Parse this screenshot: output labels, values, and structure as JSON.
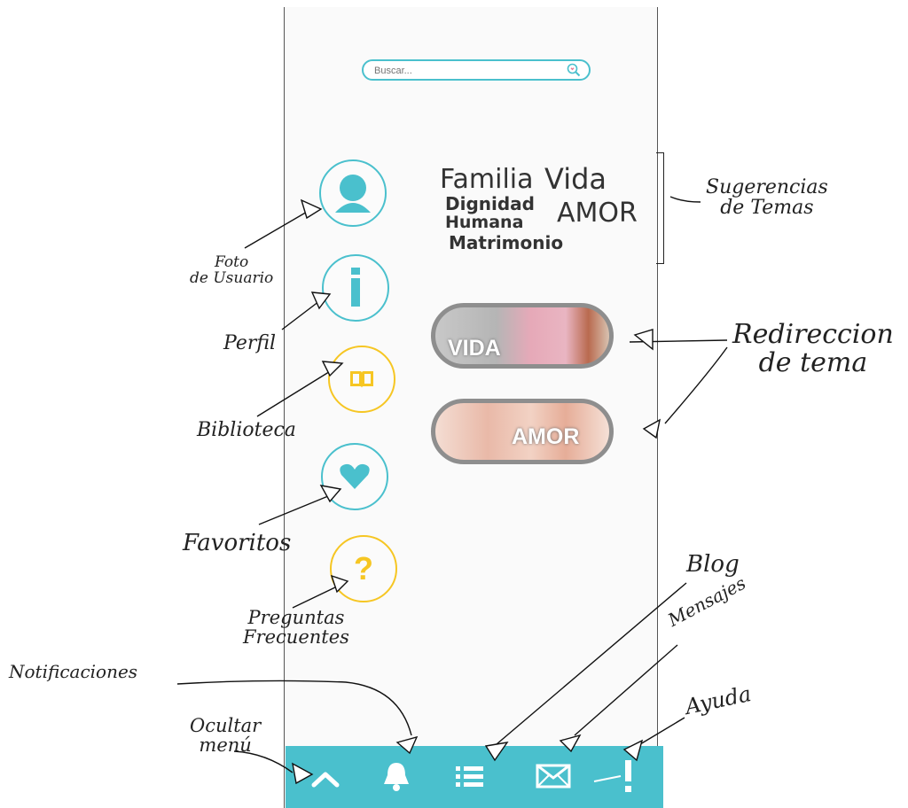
{
  "search": {
    "placeholder": "Buscar..."
  },
  "side_menu": {
    "user_photo": "avatar-icon",
    "profile": "info-icon",
    "library": "book-icon",
    "favorites": "heart-icon",
    "faq_symbol": "?"
  },
  "topic_suggestions": [
    "Familia",
    "Vida",
    "Dignidad",
    "Humana",
    "AMOR",
    "Matrimonio"
  ],
  "topic_buttons": [
    {
      "label": "VIDA"
    },
    {
      "label": "AMOR"
    }
  ],
  "bottom_bar": {
    "icons": [
      "chevron-up-icon",
      "bell-icon",
      "list-icon",
      "mail-icon",
      "exclamation-icon"
    ]
  },
  "annotations": {
    "foto_usuario": "Foto\nde Usuario",
    "perfil": "Perfil",
    "biblioteca": "Biblioteca",
    "favoritos": "Favoritos",
    "preguntas": "Preguntas\nFrecuentes",
    "notificaciones": "Notificaciones",
    "ocultar_menu": "Ocultar\nmenú",
    "sugerencias": "Sugerencias\nde Temas",
    "redireccion": "Redireccion\nde tema",
    "blog": "Blog",
    "mensajes": "Mensajes",
    "ayuda": "Ayuda"
  },
  "colors": {
    "accent": "#4ac0cd",
    "yellow": "#f6c623",
    "bar": "#4ac0cd"
  }
}
